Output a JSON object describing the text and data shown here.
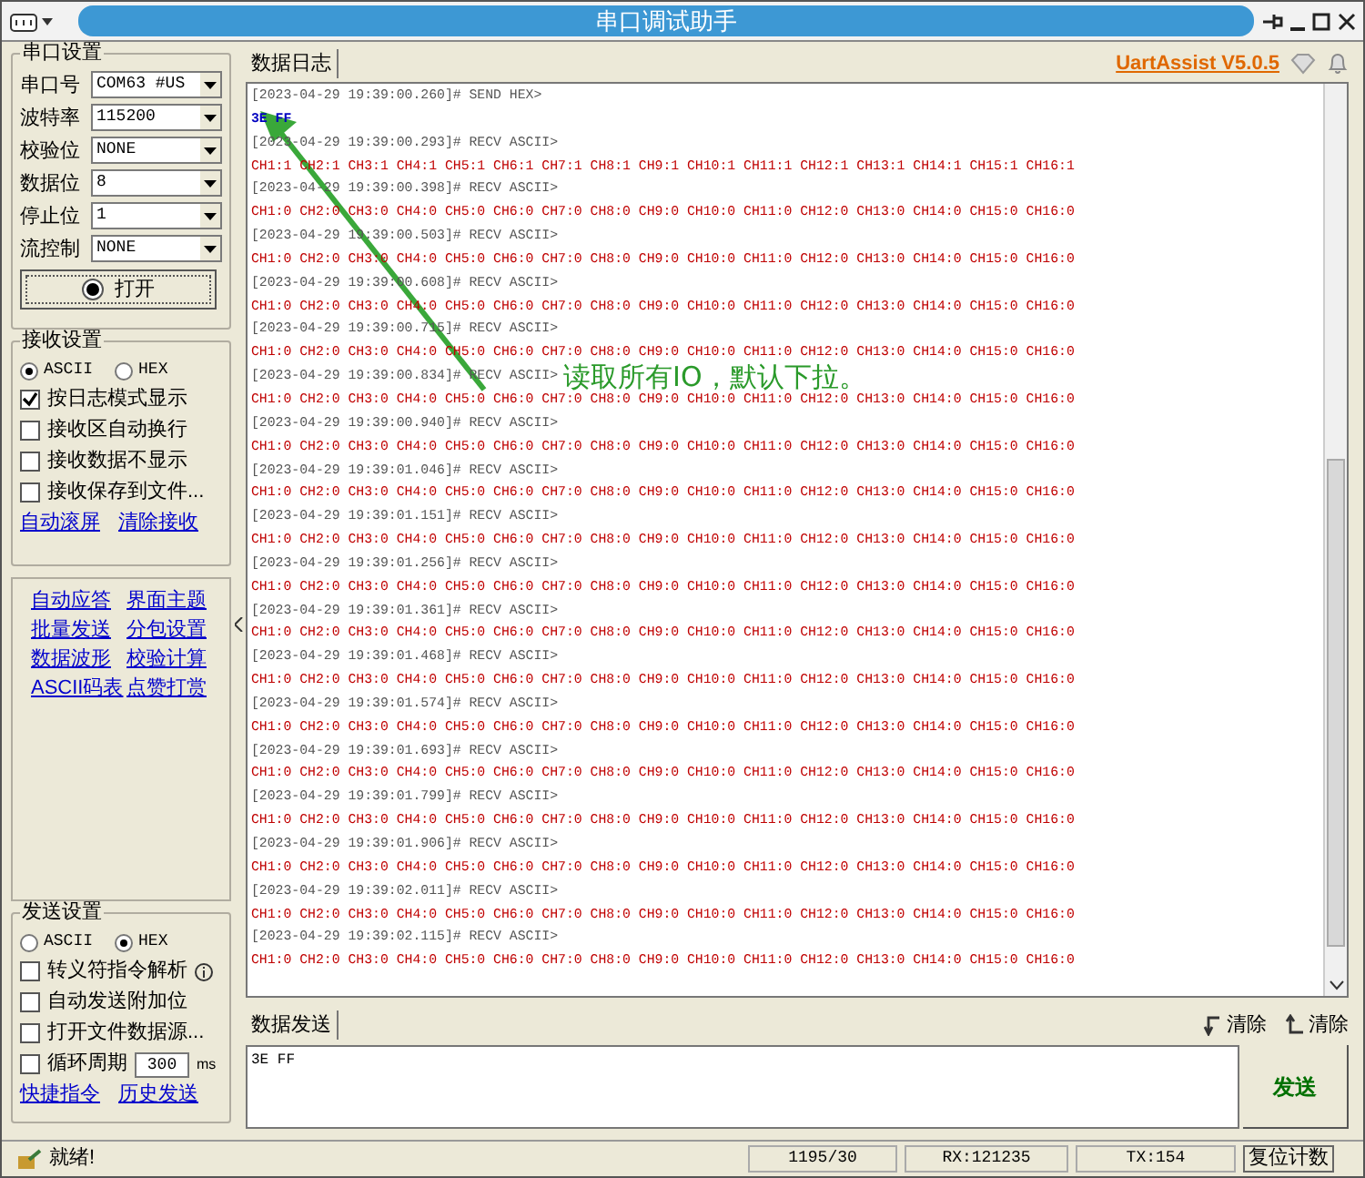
{
  "window": {
    "title": "串口调试助手"
  },
  "serial_settings": {
    "title": "串口设置",
    "fields": [
      {
        "label": "串口号",
        "value": "COM63 #US"
      },
      {
        "label": "波特率",
        "value": "115200"
      },
      {
        "label": "校验位",
        "value": "NONE"
      },
      {
        "label": "数据位",
        "value": "8"
      },
      {
        "label": "停止位",
        "value": "1"
      },
      {
        "label": "流控制",
        "value": "NONE"
      }
    ],
    "open_button": "打开"
  },
  "receive_settings": {
    "title": "接收设置",
    "modes": [
      {
        "label": "ASCII",
        "selected": true
      },
      {
        "label": "HEX",
        "selected": false
      }
    ],
    "options": [
      {
        "label": "按日志模式显示",
        "checked": true
      },
      {
        "label": "接收区自动换行",
        "checked": false
      },
      {
        "label": "接收数据不显示",
        "checked": false
      },
      {
        "label": "接收保存到文件...",
        "checked": false
      }
    ],
    "links": [
      "自动滚屏",
      "清除接收"
    ]
  },
  "tools": [
    "自动应答",
    "界面主题",
    "批量发送",
    "分包设置",
    "数据波形",
    "校验计算",
    "ASCII码表",
    "点赞打赏"
  ],
  "send_settings": {
    "title": "发送设置",
    "modes": [
      {
        "label": "ASCII",
        "selected": false
      },
      {
        "label": "HEX",
        "selected": true
      }
    ],
    "options": [
      {
        "label": "转义符指令解析",
        "checked": false,
        "info": true
      },
      {
        "label": "自动发送附加位",
        "checked": false
      },
      {
        "label": "打开文件数据源...",
        "checked": false
      },
      {
        "label": "循环周期",
        "checked": false,
        "value": "300",
        "unit": "ms"
      }
    ],
    "links": [
      "快捷指令",
      "历史发送"
    ]
  },
  "log_tab": "数据日志",
  "version": "UartAssist V5.0.5",
  "log": [
    {
      "kind": "send",
      "header": "[2023-04-29 19:39:00.260]# SEND HEX>",
      "body": "3E FF"
    },
    {
      "kind": "recv",
      "header": "[2023-04-29 19:39:00.293]# RECV ASCII>",
      "body": "CH1:1 CH2:1 CH3:1 CH4:1 CH5:1 CH6:1 CH7:1 CH8:1 CH9:1 CH10:1 CH11:1 CH12:1 CH13:1 CH14:1 CH15:1 CH16:1"
    },
    {
      "kind": "recv",
      "header": "[2023-04-29 19:39:00.398]# RECV ASCII>",
      "body": "CH1:0 CH2:0 CH3:0 CH4:0 CH5:0 CH6:0 CH7:0 CH8:0 CH9:0 CH10:0 CH11:0 CH12:0 CH13:0 CH14:0 CH15:0 CH16:0"
    },
    {
      "kind": "recv",
      "header": "[2023-04-29 19:39:00.503]# RECV ASCII>",
      "body": "CH1:0 CH2:0 CH3:0 CH4:0 CH5:0 CH6:0 CH7:0 CH8:0 CH9:0 CH10:0 CH11:0 CH12:0 CH13:0 CH14:0 CH15:0 CH16:0"
    },
    {
      "kind": "recv",
      "header": "[2023-04-29 19:39:00.608]# RECV ASCII>",
      "body": "CH1:0 CH2:0 CH3:0 CH4:0 CH5:0 CH6:0 CH7:0 CH8:0 CH9:0 CH10:0 CH11:0 CH12:0 CH13:0 CH14:0 CH15:0 CH16:0"
    },
    {
      "kind": "recv",
      "header": "[2023-04-29 19:39:00.715]# RECV ASCII>",
      "body": "CH1:0 CH2:0 CH3:0 CH4:0 CH5:0 CH6:0 CH7:0 CH8:0 CH9:0 CH10:0 CH11:0 CH12:0 CH13:0 CH14:0 CH15:0 CH16:0"
    },
    {
      "kind": "recv",
      "header": "[2023-04-29 19:39:00.834]# RECV ASCII>",
      "note": "读取所有IO，默认下拉。",
      "body": "CH1:0 CH2:0 CH3:0 CH4:0 CH5:0 CH6:0 CH7:0 CH8:0 CH9:0 CH10:0 CH11:0 CH12:0 CH13:0 CH14:0 CH15:0 CH16:0"
    },
    {
      "kind": "recv",
      "header": "[2023-04-29 19:39:00.940]# RECV ASCII>",
      "body": "CH1:0 CH2:0 CH3:0 CH4:0 CH5:0 CH6:0 CH7:0 CH8:0 CH9:0 CH10:0 CH11:0 CH12:0 CH13:0 CH14:0 CH15:0 CH16:0"
    },
    {
      "kind": "recv",
      "header": "[2023-04-29 19:39:01.046]# RECV ASCII>",
      "body": "CH1:0 CH2:0 CH3:0 CH4:0 CH5:0 CH6:0 CH7:0 CH8:0 CH9:0 CH10:0 CH11:0 CH12:0 CH13:0 CH14:0 CH15:0 CH16:0"
    },
    {
      "kind": "recv",
      "header": "[2023-04-29 19:39:01.151]# RECV ASCII>",
      "body": "CH1:0 CH2:0 CH3:0 CH4:0 CH5:0 CH6:0 CH7:0 CH8:0 CH9:0 CH10:0 CH11:0 CH12:0 CH13:0 CH14:0 CH15:0 CH16:0"
    },
    {
      "kind": "recv",
      "header": "[2023-04-29 19:39:01.256]# RECV ASCII>",
      "body": "CH1:0 CH2:0 CH3:0 CH4:0 CH5:0 CH6:0 CH7:0 CH8:0 CH9:0 CH10:0 CH11:0 CH12:0 CH13:0 CH14:0 CH15:0 CH16:0"
    },
    {
      "kind": "recv",
      "header": "[2023-04-29 19:39:01.361]# RECV ASCII>",
      "body": "CH1:0 CH2:0 CH3:0 CH4:0 CH5:0 CH6:0 CH7:0 CH8:0 CH9:0 CH10:0 CH11:0 CH12:0 CH13:0 CH14:0 CH15:0 CH16:0"
    },
    {
      "kind": "recv",
      "header": "[2023-04-29 19:39:01.468]# RECV ASCII>",
      "body": "CH1:0 CH2:0 CH3:0 CH4:0 CH5:0 CH6:0 CH7:0 CH8:0 CH9:0 CH10:0 CH11:0 CH12:0 CH13:0 CH14:0 CH15:0 CH16:0"
    },
    {
      "kind": "recv",
      "header": "[2023-04-29 19:39:01.574]# RECV ASCII>",
      "body": "CH1:0 CH2:0 CH3:0 CH4:0 CH5:0 CH6:0 CH7:0 CH8:0 CH9:0 CH10:0 CH11:0 CH12:0 CH13:0 CH14:0 CH15:0 CH16:0"
    },
    {
      "kind": "recv",
      "header": "[2023-04-29 19:39:01.693]# RECV ASCII>",
      "body": "CH1:0 CH2:0 CH3:0 CH4:0 CH5:0 CH6:0 CH7:0 CH8:0 CH9:0 CH10:0 CH11:0 CH12:0 CH13:0 CH14:0 CH15:0 CH16:0"
    },
    {
      "kind": "recv",
      "header": "[2023-04-29 19:39:01.799]# RECV ASCII>",
      "body": "CH1:0 CH2:0 CH3:0 CH4:0 CH5:0 CH6:0 CH7:0 CH8:0 CH9:0 CH10:0 CH11:0 CH12:0 CH13:0 CH14:0 CH15:0 CH16:0"
    },
    {
      "kind": "recv",
      "header": "[2023-04-29 19:39:01.906]# RECV ASCII>",
      "body": "CH1:0 CH2:0 CH3:0 CH4:0 CH5:0 CH6:0 CH7:0 CH8:0 CH9:0 CH10:0 CH11:0 CH12:0 CH13:0 CH14:0 CH15:0 CH16:0"
    },
    {
      "kind": "recv",
      "header": "[2023-04-29 19:39:02.011]# RECV ASCII>",
      "body": "CH1:0 CH2:0 CH3:0 CH4:0 CH5:0 CH6:0 CH7:0 CH8:0 CH9:0 CH10:0 CH11:0 CH12:0 CH13:0 CH14:0 CH15:0 CH16:0"
    },
    {
      "kind": "recv",
      "header": "[2023-04-29 19:39:02.115]# RECV ASCII>",
      "body": "CH1:0 CH2:0 CH3:0 CH4:0 CH5:0 CH6:0 CH7:0 CH8:0 CH9:0 CH10:0 CH11:0 CH12:0 CH13:0 CH14:0 CH15:0 CH16:0"
    }
  ],
  "send_tab": "数据发送",
  "clear_buttons": [
    "清除",
    "清除"
  ],
  "send_text": "3E FF",
  "send_button": "发送",
  "status_bar": {
    "text": "就绪!",
    "counter": "1195/30",
    "rx": "RX:121235",
    "tx": "TX:154",
    "reset": "复位计数"
  }
}
